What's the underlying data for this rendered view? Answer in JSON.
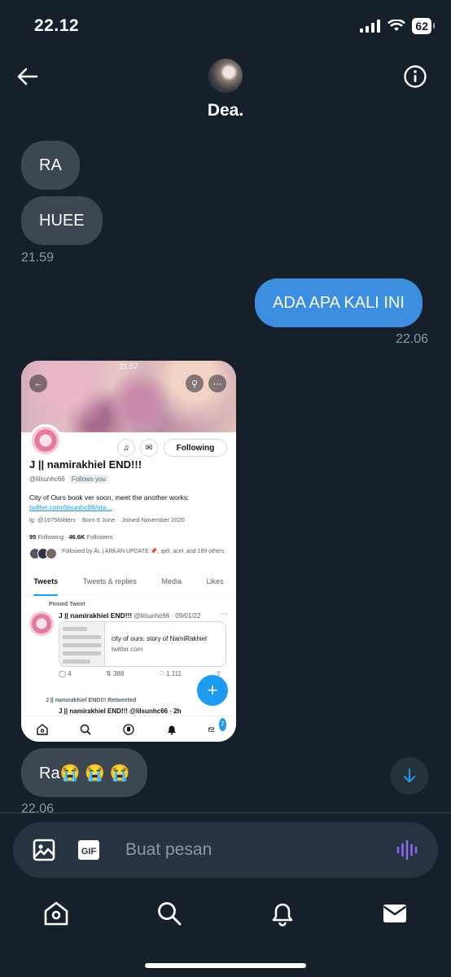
{
  "status_bar": {
    "time": "22.12",
    "battery": "62"
  },
  "header": {
    "title": "Dea."
  },
  "messages": [
    {
      "text": "RA"
    },
    {
      "text": "HUEE"
    },
    {
      "time": "21.59"
    },
    {
      "text": "ADA APA KALI INI"
    },
    {
      "time": "22.06"
    },
    {
      "text": "Ra😭 😭 😭"
    },
    {
      "time": "22.06"
    }
  ],
  "shared_screenshot": {
    "time": "21:57",
    "follow_button": "Following",
    "name": "J || namirakhiel END!!!",
    "handle": "@lilsunhc66",
    "follows_you": "Follows you",
    "bio": "City of Ours book ver soon, meet the another works:",
    "bio_link": "twitter.com/lilsunhc66/sta...",
    "meta_ig": "ig: @1975folders",
    "meta_born": "Born 6 June",
    "meta_joined": "Joined November 2020",
    "following_count": "95",
    "following_label": "Following",
    "followers_count": "46.6K",
    "followers_label": "Followers",
    "followed_by": "Followed by ÅL | ARKAN UPDATE 📌, ajél, acel, and 189 others",
    "tabs": [
      "Tweets",
      "Tweets & replies",
      "Media",
      "Likes"
    ],
    "pinned_label": "Pinned Tweet",
    "tweet_name": "J || namirakhiel END!!!",
    "tweet_handle_date": "@lilsunhc66 · 09/01/22",
    "card_title": "city of ours: story of NamiRakhiel",
    "card_domain": "twitter.com",
    "replies": "4",
    "retweets": "388",
    "likes": "1.111",
    "retweeted_label": "J || namirakhiel END!!! Retweeted",
    "retweet_line": "J || namirakhiel END!!! @lilsunhc66 · 2h",
    "badge": "2"
  },
  "composer": {
    "placeholder": "Buat pesan"
  },
  "colors": {
    "background": "#15202b",
    "sent_bubble": "#3b8ee0",
    "received_bubble": "#3d4751",
    "accent": "#1d9bf0"
  }
}
